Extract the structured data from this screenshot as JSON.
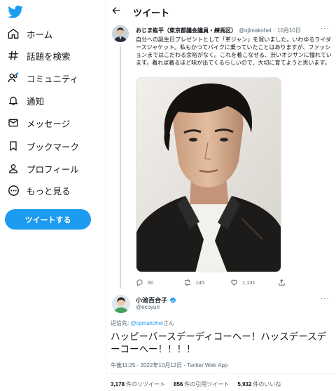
{
  "brand": {
    "accent": "#1d9bf0",
    "logo_icon": "twitter-bird-icon"
  },
  "sidebar": {
    "items": [
      {
        "label": "ホーム",
        "icon": "home-icon"
      },
      {
        "label": "話題を検索",
        "icon": "hashtag-icon"
      },
      {
        "label": "コミュニティ",
        "icon": "community-icon"
      },
      {
        "label": "通知",
        "icon": "bell-icon"
      },
      {
        "label": "メッセージ",
        "icon": "mail-icon"
      },
      {
        "label": "ブックマーク",
        "icon": "bookmark-icon"
      },
      {
        "label": "プロフィール",
        "icon": "profile-icon"
      },
      {
        "label": "もっと見る",
        "icon": "more-icon"
      }
    ],
    "tweet_button": "ツイートする"
  },
  "header": {
    "title": "ツイート",
    "back_icon": "arrow-left-icon"
  },
  "parent_tweet": {
    "author_name": "おじま紘平（東京都議会議員・練馬区）",
    "handle": "@ojimakohei",
    "separator": "·",
    "date": "10月10日",
    "text": "自分への誕生日プレゼントとして「革ジャン」を買いました。いわゆるライダースジャケット。私もかつてバイクに乗っていたことはありますが、ファッションまではこだわる余裕がなく。これを着こなせる、渋いオジサンに憧れています。着れば着るほど味が出てくるらしいので、大切に育てようと思います。",
    "image_alt_icon": "selfie-photo",
    "replies": "60",
    "retweets": "145",
    "likes": "1,131"
  },
  "reply_tweet": {
    "author_name": "小池百合子",
    "handle": "@ecoyuri",
    "verified_icon": "verified-badge-icon",
    "reply_prefix": "返信先:",
    "reply_target": "@ojimakohei",
    "reply_suffix": "さん",
    "text": "ハッピーバースデーディコーへー！ハッスデースデーコーへー！！！！",
    "meta": "午後11:25 · 2022年10月12日 · Twitter Web App",
    "stats": {
      "retweets_value": "3,178",
      "retweets_label": "件のリツイート",
      "quotes_value": "856",
      "quotes_label": "件の引用ツイート",
      "likes_value": "5,932",
      "likes_label": "件のいいね"
    }
  }
}
